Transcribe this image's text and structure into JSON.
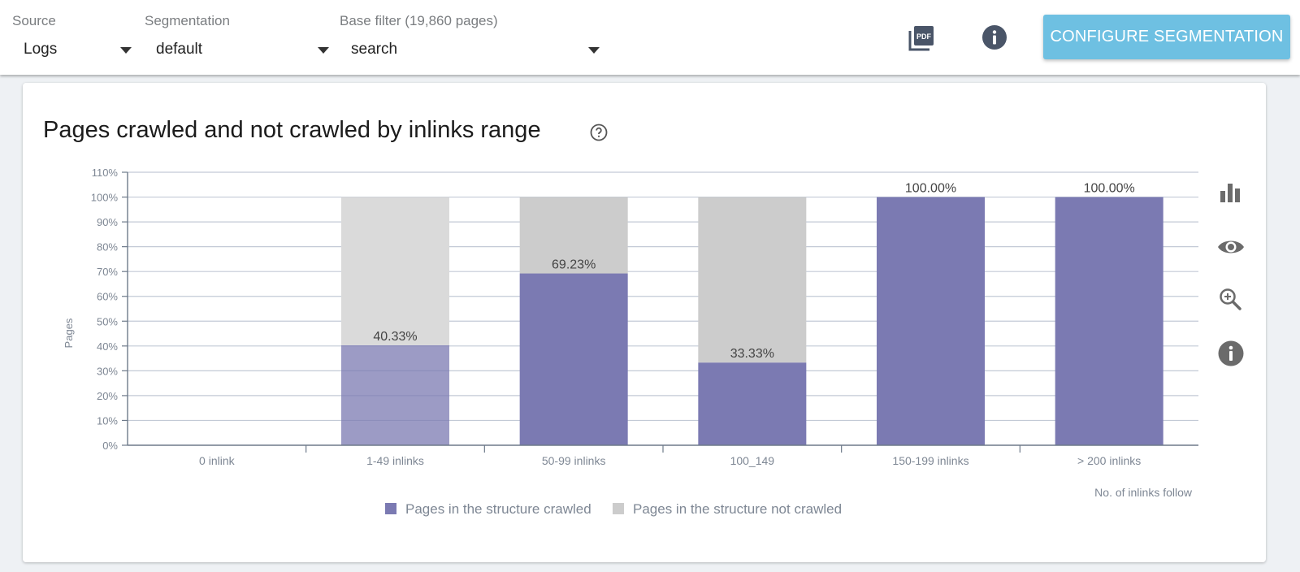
{
  "topbar": {
    "source": {
      "label": "Source",
      "value": "Logs"
    },
    "segmentation": {
      "label": "Segmentation",
      "value": "default"
    },
    "base_filter": {
      "label": "Base filter (19,860 pages)",
      "value": "search"
    },
    "pdf_icon": "pdf-export-icon",
    "info_icon": "info-icon",
    "configure_button": "CONFIGURE SEGMENTATION",
    "accent_color": "#6ec0e2"
  },
  "card": {
    "title": "Pages crawled and not crawled by inlinks range",
    "help_icon": "help-circle-icon",
    "tools": [
      "bar-chart-icon",
      "eye-icon",
      "zoom-in-icon",
      "info-icon"
    ]
  },
  "chart_data": {
    "type": "bar",
    "stacked": true,
    "percent": true,
    "title": "Pages crawled and not crawled by inlinks range",
    "xlabel": "No. of inlinks follow",
    "ylabel": "Pages",
    "ylim": [
      0,
      110
    ],
    "yticks": [
      "0%",
      "10%",
      "20%",
      "30%",
      "40%",
      "50%",
      "60%",
      "70%",
      "80%",
      "90%",
      "100%",
      "110%"
    ],
    "grid": true,
    "categories": [
      "0 inlink",
      "1-49 inlinks",
      "50-99 inlinks",
      "100_149",
      "150-199 inlinks",
      "> 200 inlinks"
    ],
    "series": [
      {
        "name": "Pages in the structure crawled",
        "color": "#7b7ab2",
        "values": [
          0,
          40.33,
          69.23,
          33.33,
          100,
          100
        ]
      },
      {
        "name": "Pages in the structure not crawled",
        "color": "#cccccc",
        "values": [
          0,
          59.67,
          30.77,
          66.67,
          0,
          0
        ]
      }
    ],
    "data_labels": [
      "",
      "40.33%",
      "69.23%",
      "33.33%",
      "100.00%",
      "100.00%"
    ],
    "highlighted_category": "1-49 inlinks",
    "legend_position": "bottom"
  }
}
